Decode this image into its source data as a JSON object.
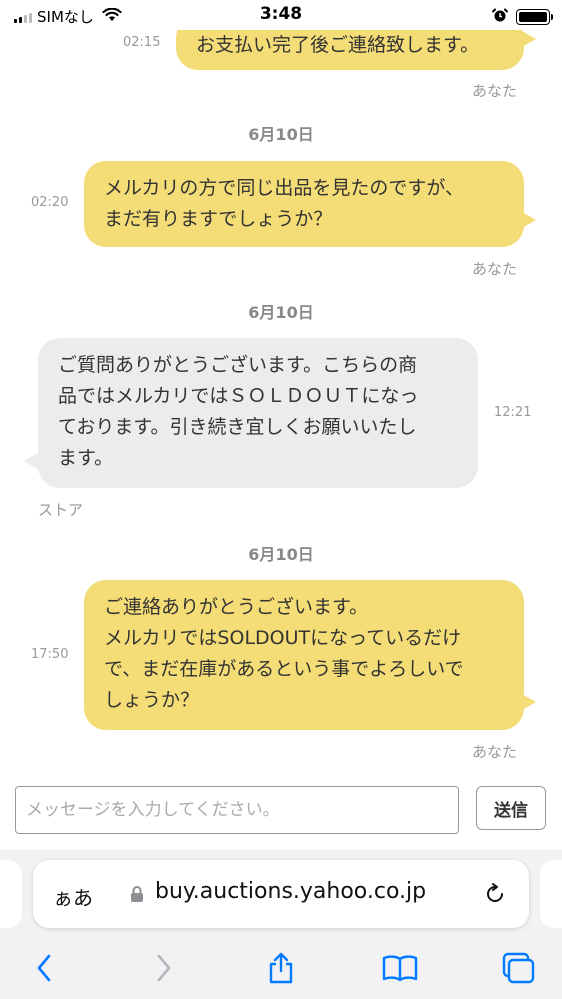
{
  "status_bar": {
    "carrier": "SIMなし",
    "time": "3:48"
  },
  "messages": [
    {
      "id": "m1",
      "from": "me",
      "lines": [
        "お支払い完了後ご連絡致します。"
      ],
      "time": "02:15",
      "sender": "あなた"
    },
    {
      "id": "m2",
      "date": "6月10日",
      "from": "me",
      "lines": [
        "メルカリの方で同じ出品を見たのですが、",
        "まだ有りますでしょうか？"
      ],
      "time": "02:20",
      "sender": "あなた"
    },
    {
      "id": "m3",
      "date": "6月10日",
      "from": "store",
      "lines": [
        "ご質問ありがとうございます。こちらの商",
        "品ではメルカリではＳＯＬＤＯＵＴになっ",
        "ております。引き続き宜しくお願いいたし",
        "ます。"
      ],
      "time": "12:21",
      "sender": "ストア"
    },
    {
      "id": "m4",
      "date": "6月10日",
      "from": "me",
      "lines": [
        "ご連絡ありがとうございます。",
        "メルカリではSOLDOUTになっているだけ",
        "で、まだ在庫があるという事でよろしいで",
        "しょうか？"
      ],
      "time": "17:50",
      "sender": "あなた"
    }
  ],
  "composer": {
    "placeholder": "メッセージを入力してください。",
    "send_label": "送信"
  },
  "browser": {
    "aa_label": "ぁあ",
    "url": "buy.auctions.yahoo.co.jp"
  },
  "colors": {
    "my_bubble": "#f4dc76",
    "store_bubble": "#ececec",
    "ios_blue": "#007aff"
  },
  "icons": [
    "wifi-icon",
    "alarm-icon",
    "battery-icon",
    "lock-icon",
    "reload-icon",
    "back-icon",
    "forward-icon",
    "share-icon",
    "bookmarks-icon",
    "tabs-icon"
  ]
}
